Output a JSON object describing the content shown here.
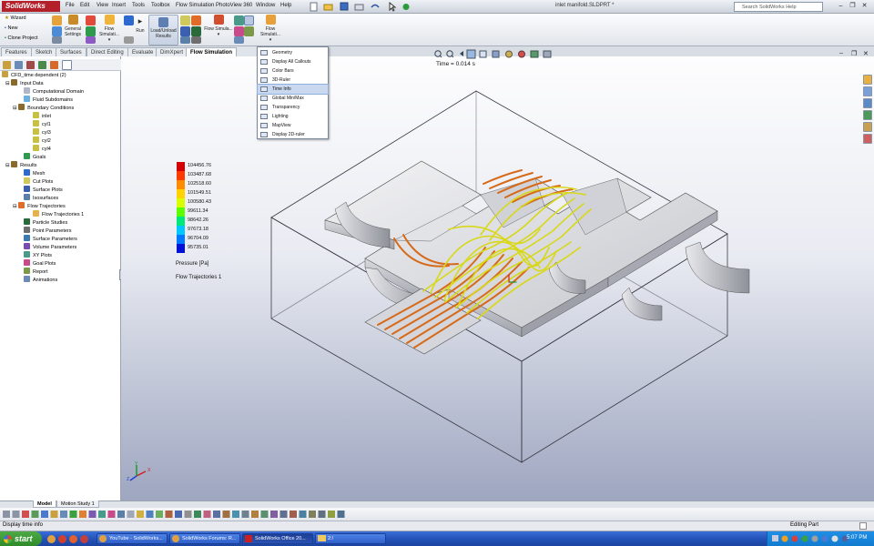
{
  "app": {
    "name": "SolidWorks",
    "document_title": "inlet manifold.SLDPRT *"
  },
  "menu": [
    "File",
    "Edit",
    "View",
    "Insert",
    "Tools",
    "Toolbox",
    "Flow Simulation",
    "PhotoView 360",
    "Window",
    "Help"
  ],
  "search": {
    "placeholder": "Search SolidWorks Help"
  },
  "ribbon": {
    "wizard": "Wizard",
    "new": "New",
    "clone_project": "Clone Project",
    "general_settings": "General Settings",
    "flow_simulation_1": "Flow Simulati...",
    "run": "Run",
    "load_unload_results": "Load/Unload Results",
    "flow_simulation_2": "Flow Simula...",
    "flow_simulation_3": "Flow Simulati..."
  },
  "command_tabs": [
    "Features",
    "Sketch",
    "Surfaces",
    "Direct Editing",
    "Evaluate",
    "DimXpert",
    "Flow Simulation"
  ],
  "active_tab": "Flow Simulation",
  "dropdown": {
    "items": [
      "Geometry",
      "Display All Callouts",
      "Color Bars",
      "3D-Ruler",
      "Time Info",
      "Global Min/Max",
      "Transparency",
      "Lighting",
      "MapView",
      "Display 2D-ruler"
    ],
    "highlighted": "Time Info"
  },
  "tree": {
    "root": "CFD_time dependent (2)",
    "input_data": "Input Data",
    "computational_domain": "Computational Domain",
    "fluid_subdomains": "Fluid Subdomains",
    "boundary_conditions": "Boundary Conditions",
    "bc_items": [
      "inlet",
      "cyl1",
      "cyl3",
      "cyl2",
      "cyl4"
    ],
    "goals": "Goals",
    "results": "Results",
    "mesh": "Mesh",
    "cut_plots": "Cut Plots",
    "surface_plots": "Surface Plots",
    "isosurfaces": "Isosurfaces",
    "flow_trajectories": "Flow Trajectories",
    "flow_trajectories_1": "Flow Trajectories 1",
    "result_items": [
      "Particle Studies",
      "Point Parameters",
      "Surface Parameters",
      "Volume Parameters",
      "XY Plots",
      "Goal Plots",
      "Report",
      "Animations"
    ]
  },
  "viewport": {
    "time_info": "Time = 0.014 s",
    "legend_values": [
      "104456.76",
      "103487.68",
      "102518.60",
      "101549.51",
      "100580.43",
      "99611.34",
      "98642.26",
      "97673.18",
      "96704.09",
      "95735.01"
    ],
    "legend_colors": [
      "#d40000",
      "#ff3a00",
      "#ff8c00",
      "#ffd200",
      "#d8ff00",
      "#5cff00",
      "#00e87a",
      "#00c8ff",
      "#0078ff",
      "#0010d8"
    ],
    "legend_unit": "Pressure [Pa]",
    "legend_title": "Flow Trajectories 1",
    "triad_x": "X",
    "triad_y": "Y",
    "triad_z": "Z"
  },
  "bottom_tabs": [
    "Model",
    "Motion Study 1"
  ],
  "status": {
    "left": "Display time info",
    "right": "Editing Part"
  },
  "taskbar": {
    "start": "start",
    "tasks": [
      "YouTube - SolidWorks...",
      "SolidWorks Forums: R...",
      "SolidWorks Office 20...",
      "2:/"
    ],
    "clock": "5:07 PM"
  }
}
